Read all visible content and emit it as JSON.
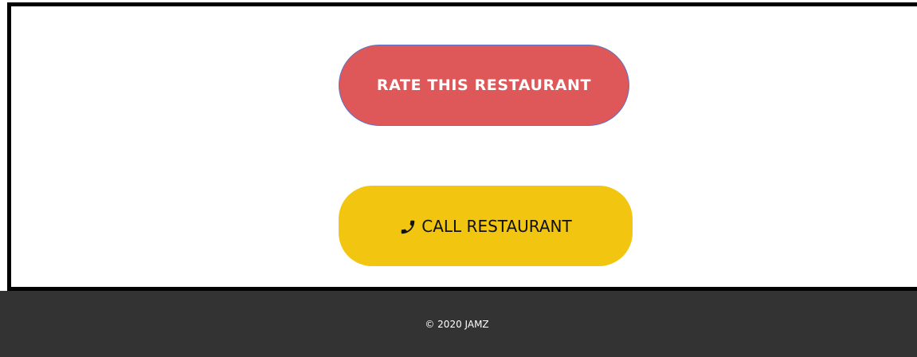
{
  "main": {
    "rate_button_label": "RATE THIS RESTAURANT",
    "call_button_label": "CALL RESTAURANT",
    "call_icon": "phone-icon"
  },
  "footer": {
    "copyright": "© 2020 JAMZ"
  },
  "colors": {
    "rate_button_bg": "#de5759",
    "rate_button_border": "#5b74c9",
    "call_button_bg": "#f2c510",
    "footer_bg": "#333333",
    "card_border": "#000000"
  }
}
